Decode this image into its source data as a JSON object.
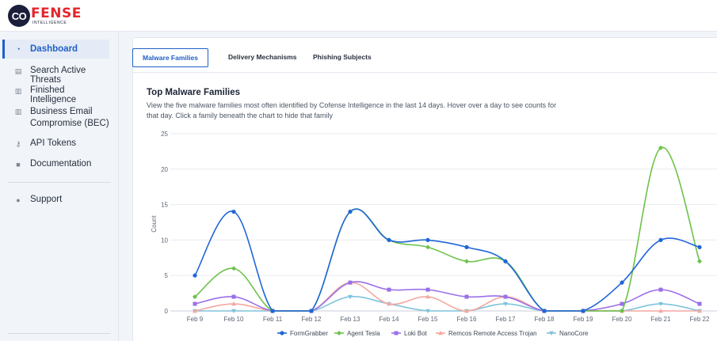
{
  "brand": {
    "mark": "CO",
    "name": "FENSE",
    "sub": "INTELLIGENCE"
  },
  "sidebar": {
    "items": [
      {
        "label": "Dashboard",
        "icon": "dashboard-icon"
      },
      {
        "label": "Search Active Threats",
        "icon": "search-list-icon"
      },
      {
        "label": "Finished Intelligence",
        "icon": "document-icon"
      },
      {
        "label": "Business Email Compromise (BEC)",
        "icon": "document-icon"
      },
      {
        "label": "API Tokens",
        "icon": "key-icon"
      },
      {
        "label": "Documentation",
        "icon": "book-icon"
      },
      {
        "label": "Support",
        "icon": "user-icon"
      }
    ]
  },
  "tabs": [
    "Malware Families",
    "Delivery Mechanisms",
    "Phishing Subjects"
  ],
  "chart_panel": {
    "title": "Top Malware Families",
    "description": "View the five malware families most often identified by Cofense Intelligence in the last 14 days. Hover over a day to see counts for that day. Click a family beneath the chart to hide that family"
  },
  "chart_data": {
    "type": "line",
    "ylabel": "Count",
    "xlabel": "",
    "ylim": [
      0,
      25
    ],
    "yticks": [
      0,
      5,
      10,
      15,
      20,
      25
    ],
    "categories": [
      "Feb 9",
      "Feb 10",
      "Feb 11",
      "Feb 12",
      "Feb 13",
      "Feb 14",
      "Feb 15",
      "Feb 16",
      "Feb 17",
      "Feb 18",
      "Feb 19",
      "Feb 20",
      "Feb 21",
      "Feb 22"
    ],
    "grid": true,
    "legend": "bottom",
    "series": [
      {
        "name": "FormGrabber",
        "color": "#1f66d8",
        "marker": "circle",
        "values": [
          5,
          14,
          0,
          0,
          14,
          10,
          10,
          9,
          7,
          0,
          0,
          4,
          10,
          9
        ]
      },
      {
        "name": "Agent Tesla",
        "color": "#6cc24a",
        "marker": "diamond",
        "values": [
          2,
          6,
          0,
          0,
          14,
          10,
          9,
          7,
          7,
          0,
          0,
          0,
          23,
          7
        ]
      },
      {
        "name": "Loki Bot",
        "color": "#9b6fe8",
        "marker": "square",
        "values": [
          1,
          2,
          0,
          0,
          4,
          3,
          3,
          2,
          2,
          0,
          0,
          1,
          3,
          1
        ]
      },
      {
        "name": "Remcos Remote Access Trojan",
        "color": "#f4a8a0",
        "marker": "triangle",
        "values": [
          0,
          1,
          0,
          0,
          4,
          1,
          2,
          0,
          2,
          0,
          0,
          0,
          0,
          0
        ]
      },
      {
        "name": "NanoCore",
        "color": "#7fc4dc",
        "marker": "triangle-down",
        "values": [
          0,
          0,
          0,
          0,
          2,
          1,
          0,
          0,
          1,
          0,
          0,
          0,
          1,
          0
        ]
      }
    ]
  }
}
